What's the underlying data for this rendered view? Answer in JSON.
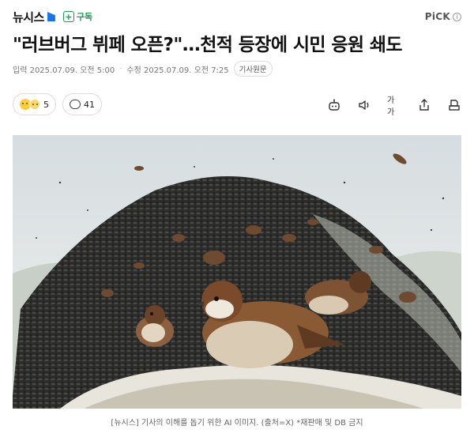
{
  "header": {
    "brand": "뉴시스",
    "subscribe_label": "구독",
    "pick_label": "PiCK",
    "pick_info": "i"
  },
  "article": {
    "title": "\"러브버그 뷔페 오픈?\"…천적 등장에 시민 응원 쇄도",
    "input_label": "입력 2025.07.09. 오전 5:00",
    "sep": "·",
    "edit_label": "수정 2025.07.09. 오전 7:25",
    "original_button": "기사원문"
  },
  "reactions": {
    "emoji_count": "5",
    "comment_count": "41"
  },
  "tools": {
    "font_size_label": "가가"
  },
  "photo": {
    "caption": "[뉴시스] 기사의 이해를 돕기 위한 AI 이미지. (출처=X) *재판매 및 DB 금지"
  },
  "colors": {
    "accent_green": "#12a150",
    "brand_blue": "#1a73e8"
  }
}
